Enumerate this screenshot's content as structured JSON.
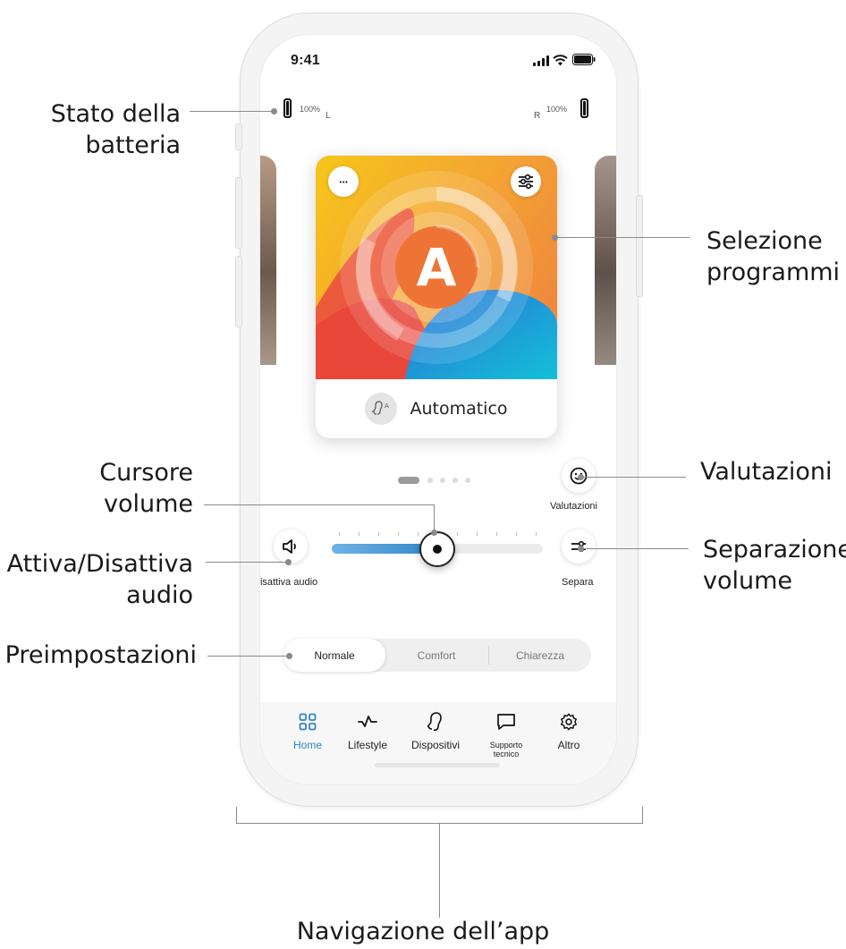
{
  "annotations": {
    "battery": [
      "Stato della",
      "batteria"
    ],
    "programs": [
      "Selezione",
      "programmi"
    ],
    "volume_slider": [
      "Cursore",
      "volume"
    ],
    "ratings": [
      "Valutazioni"
    ],
    "mute": [
      "Attiva/Disattiva",
      "audio"
    ],
    "split_volume": [
      "Separazione",
      "volume"
    ],
    "presets": [
      "Preimpostazioni"
    ],
    "navigation": [
      "Navigazione dell’app"
    ]
  },
  "status_bar": {
    "time": "9:41"
  },
  "hearing_aids": {
    "left": {
      "percent": "100%",
      "side": "L",
      "level": 1.0
    },
    "right": {
      "percent": "100%",
      "side": "R",
      "level": 1.0
    }
  },
  "program_card": {
    "letter": "A",
    "name": "Automatico",
    "menu_label": "···",
    "colors": {
      "yellow": "#f7c11d",
      "orange": "#f08a3a",
      "red": "#e8513a",
      "blue": "#1f8fd6",
      "cyan": "#19b6d8"
    }
  },
  "pager": {
    "count": 5,
    "active": 0
  },
  "controls": {
    "ratings_label": "Valutazioni",
    "mute_label": "Disattiva audio",
    "split_label": "Separa",
    "volume_level": 0.5
  },
  "presets": {
    "options": [
      "Normale",
      "Comfort",
      "Chiarezza"
    ],
    "selected": "Normale"
  },
  "bottom_nav": {
    "items": [
      {
        "label": "Home",
        "icon": "home-grid-icon",
        "active": true
      },
      {
        "label": "Lifestyle",
        "icon": "activity-icon",
        "active": false
      },
      {
        "label": "Dispositivi",
        "icon": "hearing-aid-icon",
        "active": false
      },
      {
        "label": "Supporto tecnico",
        "line1": "Supporto",
        "line2": "tecnico",
        "icon": "chat-icon",
        "active": false
      },
      {
        "label": "Altro",
        "icon": "gear-icon",
        "active": false
      }
    ]
  },
  "accent_color": "#2f86c8"
}
